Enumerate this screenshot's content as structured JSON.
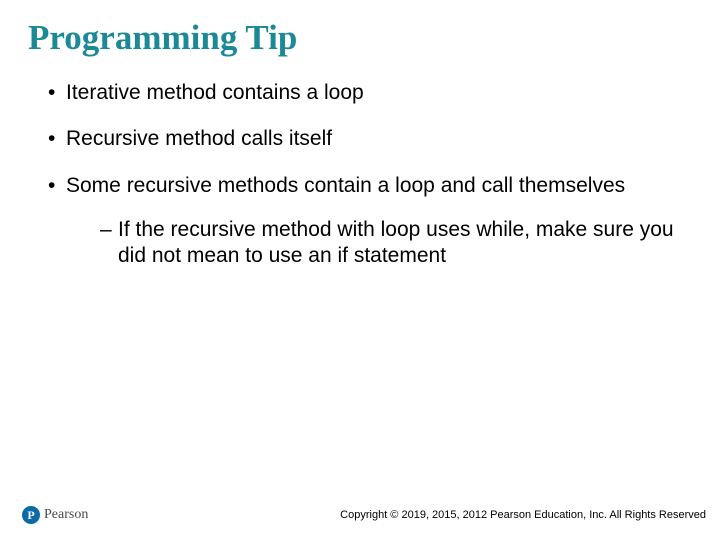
{
  "title": "Programming Tip",
  "bullets": [
    {
      "text": "Iterative method contains a loop"
    },
    {
      "text": "Recursive method calls itself"
    },
    {
      "text": "Some recursive methods contain a loop and call themselves",
      "sub": [
        "If the recursive method with loop uses while, make sure you did not mean to use an if statement"
      ]
    }
  ],
  "logo": {
    "mark": "P",
    "text": "Pearson"
  },
  "copyright": "Copyright © 2019, 2015, 2012 Pearson Education, Inc. All Rights Reserved"
}
